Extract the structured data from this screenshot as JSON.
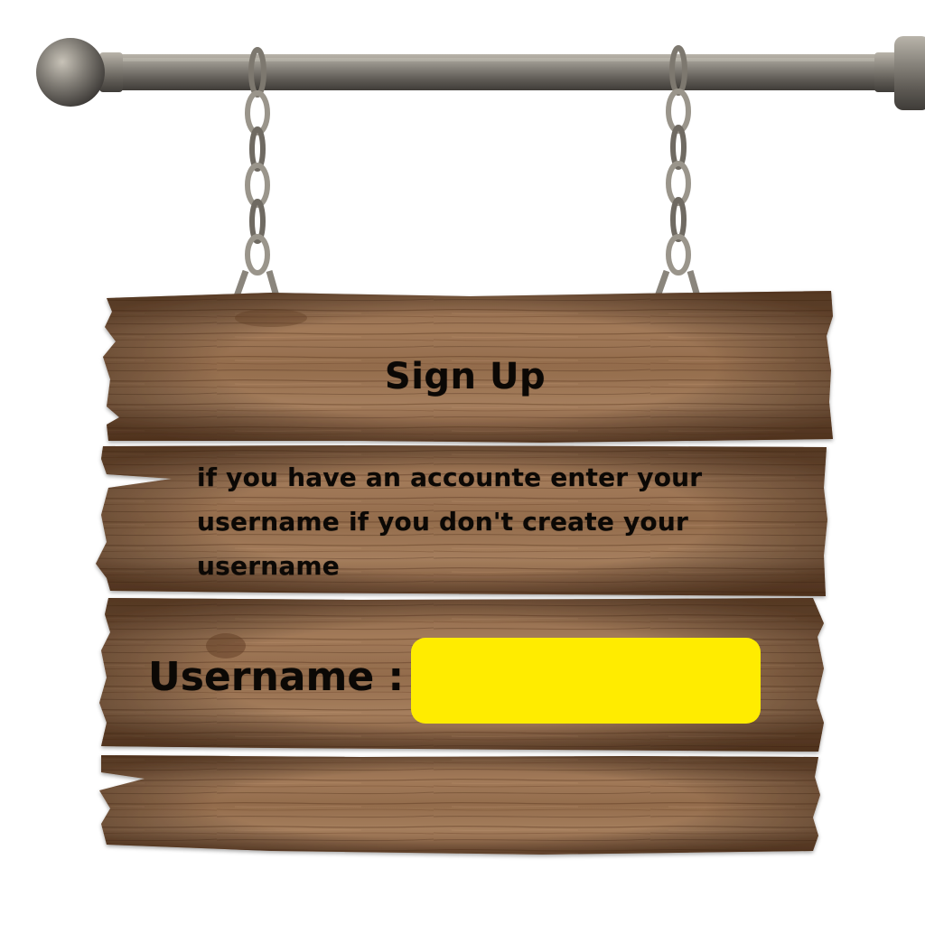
{
  "sign": {
    "title": "Sign Up",
    "instructions": "if you have an accounte enter your username if you don't create your username"
  },
  "form": {
    "username_label": "Username :",
    "username_value": "",
    "username_placeholder": ""
  },
  "colors": {
    "input_fill": "#FFEC00",
    "wood_light": "#9c7453",
    "wood_dark": "#5e3a22",
    "text": "#0b0805",
    "metal": "#8a857c"
  },
  "icons": {
    "rod": "metal-rod-icon",
    "chain": "chain-icon"
  }
}
